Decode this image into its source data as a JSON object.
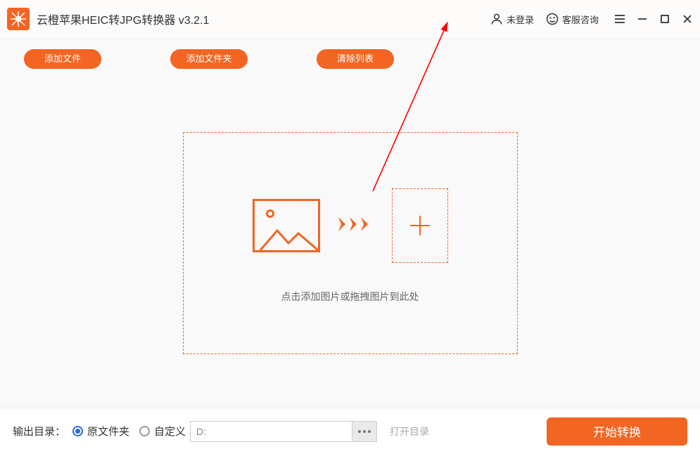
{
  "titlebar": {
    "app_title": "云橙苹果HEIC转JPG转换器 v3.2.1",
    "login_status": "未登录",
    "support_label": "客服咨询"
  },
  "toolbar": {
    "add_file_label": "添加文件",
    "add_folder_label": "添加文件夹",
    "clear_list_label": "清除列表"
  },
  "dropzone": {
    "hint": "点击添加图片或拖拽图片到此处"
  },
  "footer": {
    "output_label": "输出目录：",
    "radio_original": "原文件夹",
    "radio_custom": "自定义",
    "path_value": "D:",
    "open_dir_label": "打开目录",
    "convert_label": "开始转换"
  },
  "colors": {
    "accent": "#f26522",
    "radio_checked": "#2468f2"
  }
}
